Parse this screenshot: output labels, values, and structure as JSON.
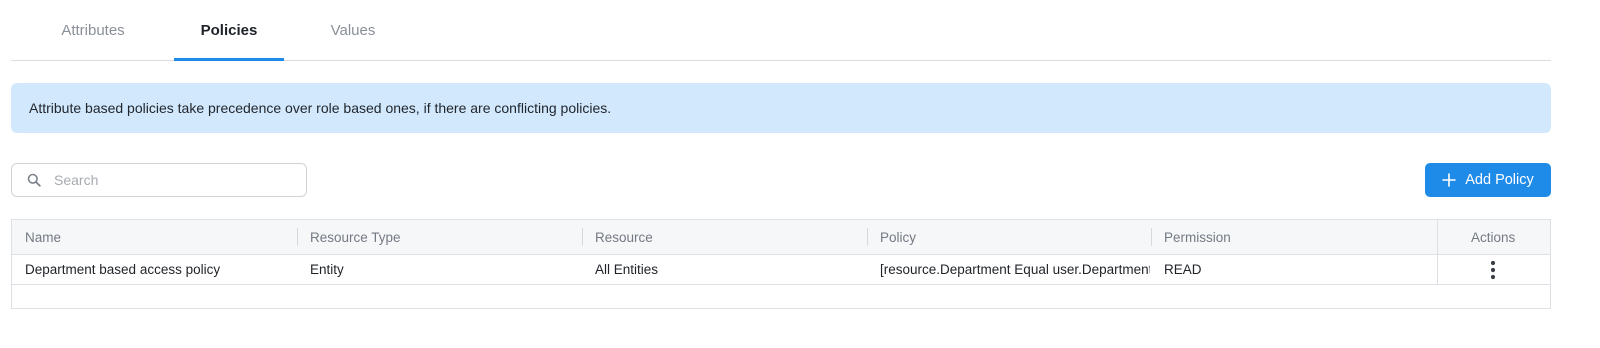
{
  "tabs": [
    {
      "label": "Attributes",
      "active": false
    },
    {
      "label": "Policies",
      "active": true
    },
    {
      "label": "Values",
      "active": false
    }
  ],
  "banner": {
    "text": "Attribute based policies take precedence over role based ones, if there are conflicting policies."
  },
  "search": {
    "placeholder": "Search",
    "value": "",
    "icon": "search-icon"
  },
  "add_button": {
    "label": "Add Policy",
    "icon": "plus-icon"
  },
  "table": {
    "columns": [
      "Name",
      "Resource Type",
      "Resource",
      "Policy",
      "Permission",
      "Actions"
    ],
    "rows": [
      {
        "name": "Department based access policy",
        "resource_type": "Entity",
        "resource": "All Entities",
        "policy": "[resource.Department Equal user.Department]",
        "permission": "READ",
        "actions_icon": "more-vertical-icon"
      }
    ]
  },
  "colors": {
    "accent": "#1f8be9",
    "banner_bg": "#d2e8fc"
  }
}
